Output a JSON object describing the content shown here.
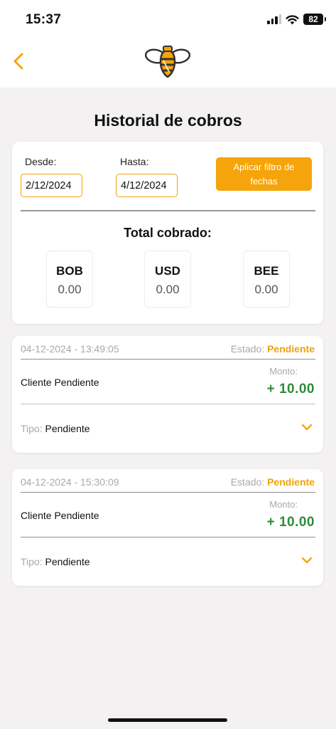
{
  "status_bar": {
    "time": "15:37",
    "battery": "82"
  },
  "header": {
    "back_icon": "chevron-left-icon",
    "logo_icon": "bee-icon"
  },
  "page": {
    "title": "Historial de cobros"
  },
  "filter": {
    "from_label": "Desde:",
    "from_value": "2/12/2024",
    "to_label": "Hasta:",
    "to_value": "4/12/2024",
    "apply_button": "Aplicar filtro de fechas"
  },
  "totals": {
    "title": "Total cobrado:",
    "currencies": [
      {
        "code": "BOB",
        "value": "0.00"
      },
      {
        "code": "USD",
        "value": "0.00"
      },
      {
        "code": "BEE",
        "value": "0.00"
      }
    ]
  },
  "transactions": [
    {
      "datetime": "04-12-2024 - 13:49:05",
      "state_label": "Estado:",
      "state_value": "Pendiente",
      "client": "Cliente Pendiente",
      "amount_label": "Monto:",
      "amount": "+ 10.00",
      "type_label": "Tipo:",
      "type_value": "Pendiente"
    },
    {
      "datetime": "04-12-2024 - 15:30:09",
      "state_label": "Estado:",
      "state_value": "Pendiente",
      "client": "Cliente Pendiente",
      "amount_label": "Monto:",
      "amount": "+ 10.00",
      "type_label": "Tipo:",
      "type_value": "Pendiente"
    }
  ],
  "colors": {
    "accent": "#f5a40b",
    "positive": "#2e8b3a",
    "muted": "#a9a9a9",
    "background": "#f3f1f1"
  }
}
